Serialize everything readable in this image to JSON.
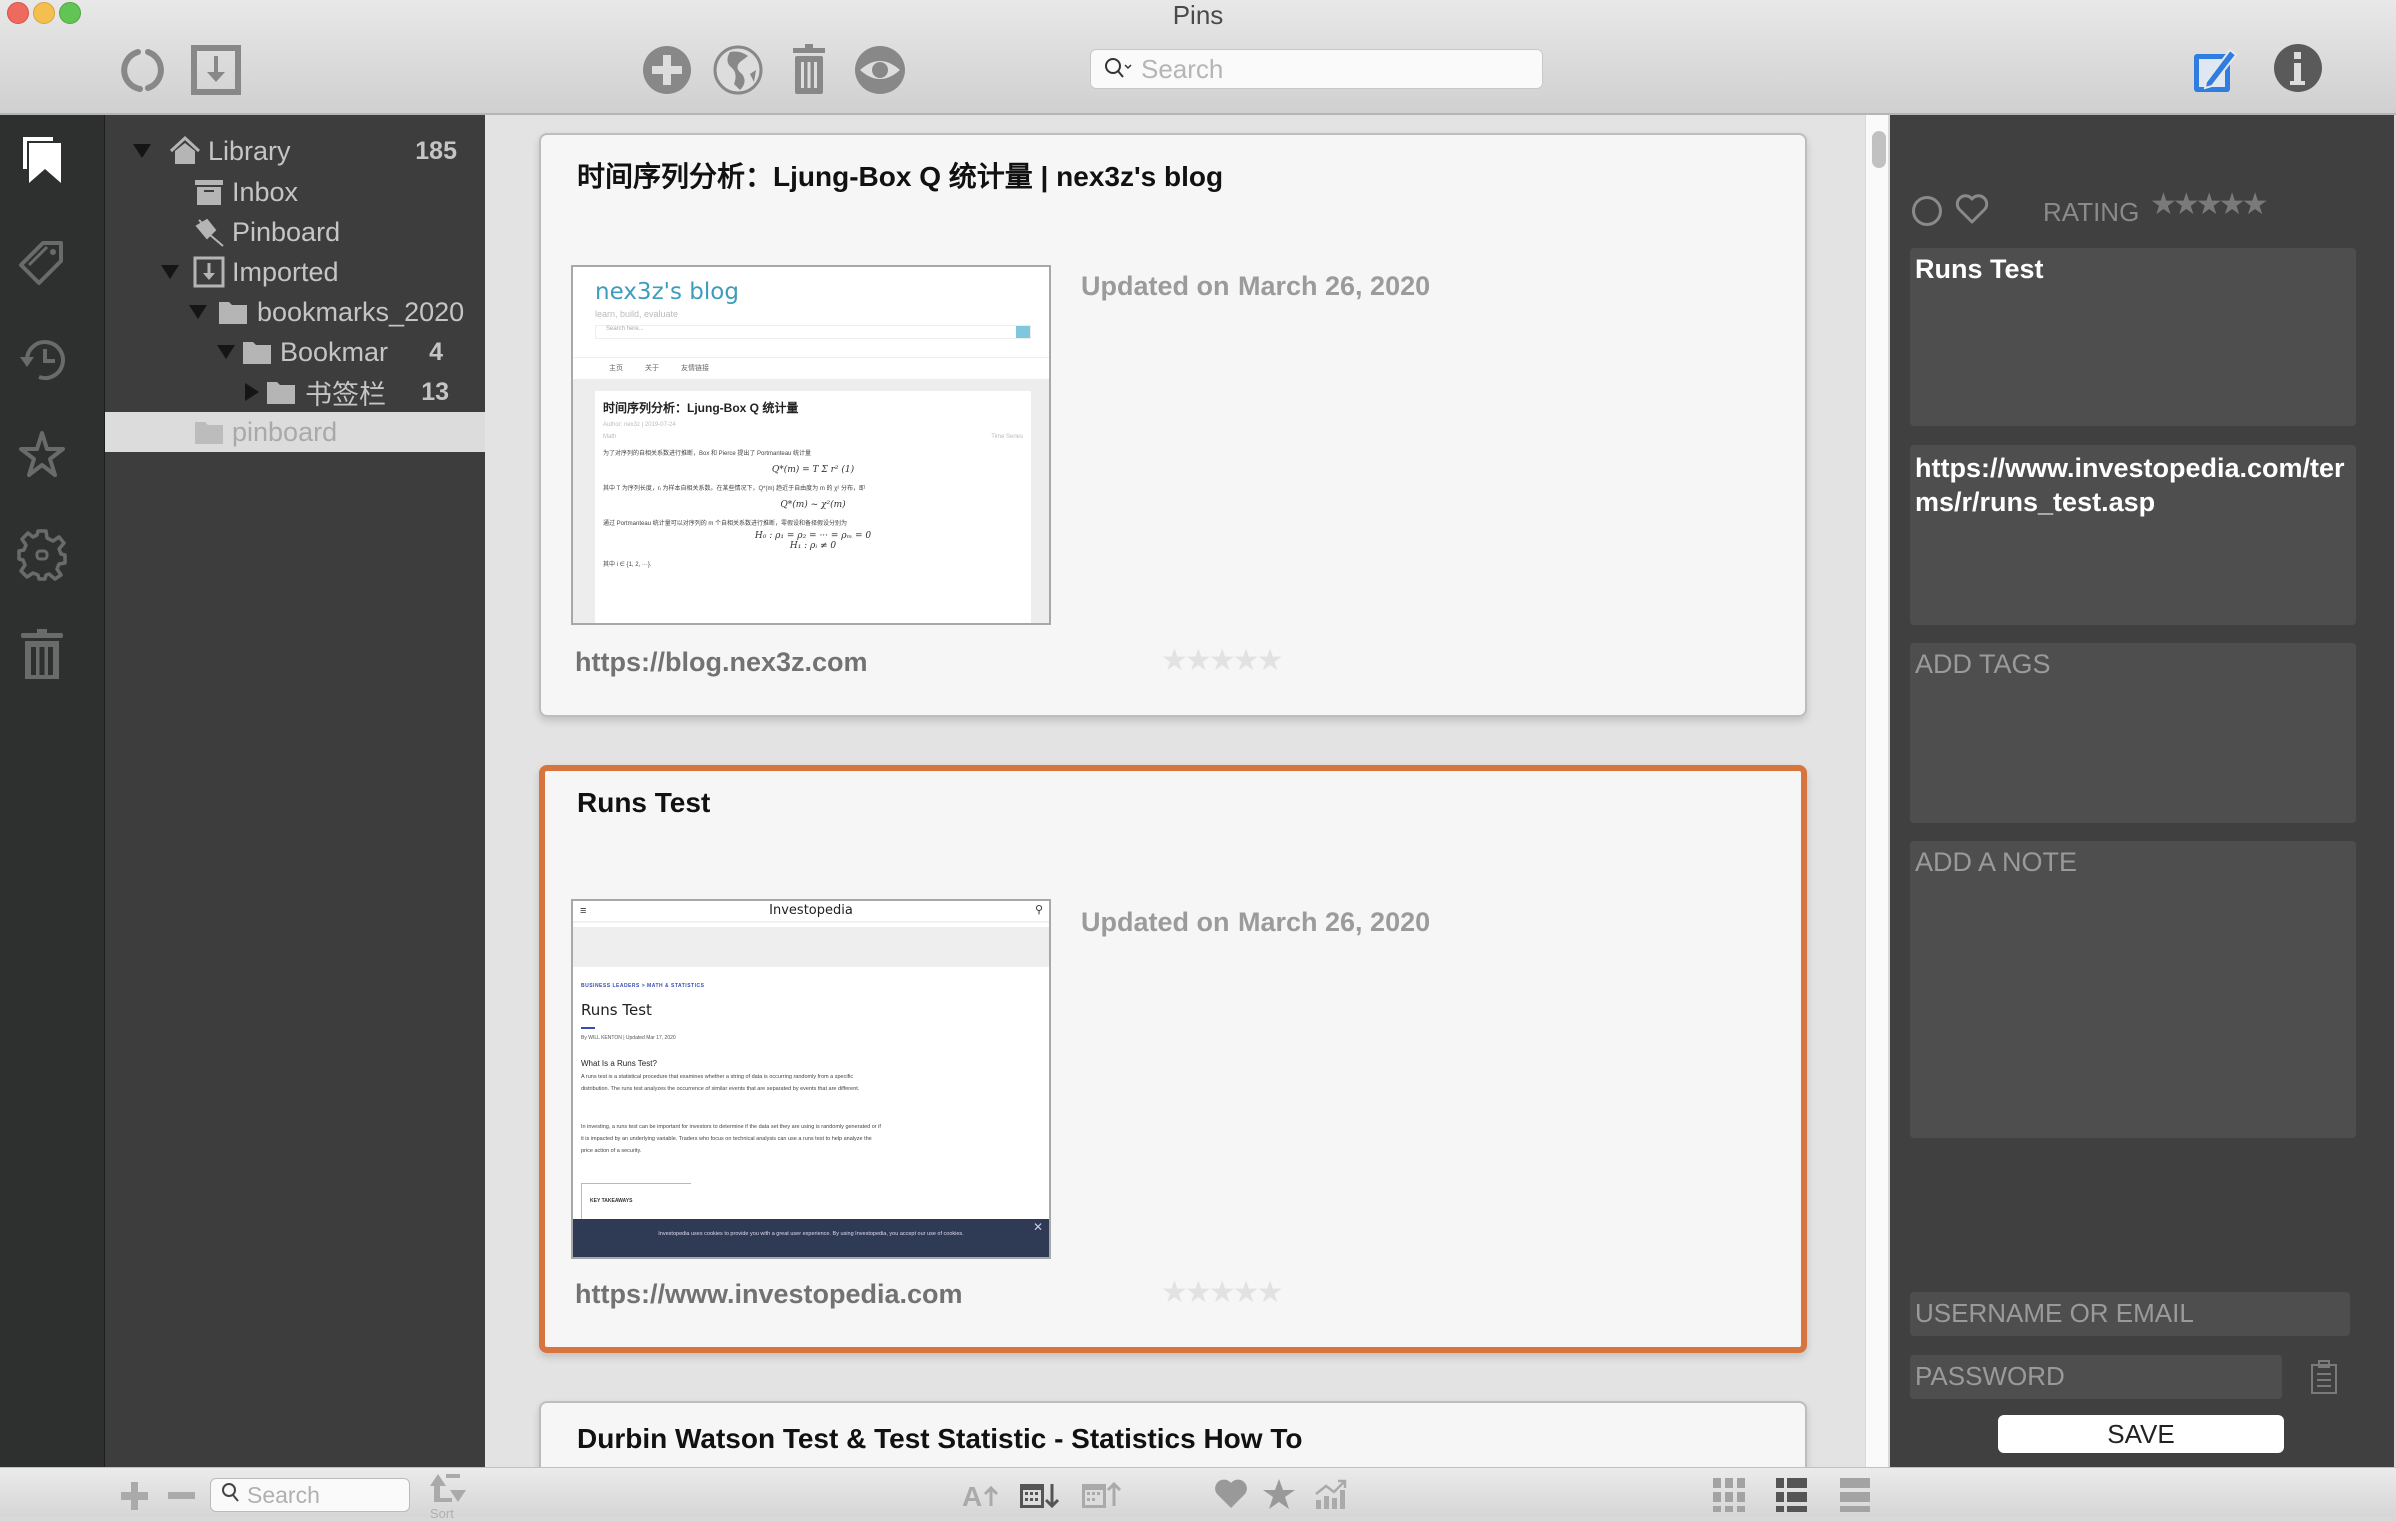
{
  "window": {
    "title": "Pins"
  },
  "toolbar": {
    "left_icons": [
      {
        "name": "refresh-icon"
      },
      {
        "name": "import-icon"
      }
    ],
    "center_icons": [
      {
        "name": "add-icon"
      },
      {
        "name": "globe-icon"
      },
      {
        "name": "trash-icon"
      },
      {
        "name": "eye-icon"
      }
    ],
    "search": {
      "placeholder": "Search",
      "value": ""
    },
    "right_icons": [
      {
        "name": "edit-icon",
        "color": "#2f7de1"
      },
      {
        "name": "info-icon"
      }
    ]
  },
  "rail": {
    "items": [
      {
        "name": "bookmarks-icon",
        "active": true
      },
      {
        "name": "tags-icon",
        "active": false
      },
      {
        "name": "history-icon",
        "active": false
      },
      {
        "name": "star-icon",
        "active": false
      },
      {
        "name": "settings-icon",
        "active": false
      },
      {
        "name": "trash-icon",
        "active": false
      }
    ]
  },
  "tree": {
    "items": [
      {
        "label": "Library",
        "count": "185",
        "icon": "home-icon",
        "disclosure": "down",
        "level": 0
      },
      {
        "label": "Inbox",
        "count": "",
        "icon": "inbox-icon",
        "disclosure": "",
        "level": 1
      },
      {
        "label": "Pinboard",
        "count": "",
        "icon": "pin-icon",
        "disclosure": "",
        "level": 1
      },
      {
        "label": "Imported",
        "count": "",
        "icon": "import-icon",
        "disclosure": "down",
        "level": 1
      },
      {
        "label": "bookmarks_2020",
        "count": "",
        "icon": "folder-icon",
        "disclosure": "down",
        "level": 2
      },
      {
        "label": "Bookmar",
        "count": "4",
        "icon": "folder-icon",
        "disclosure": "down",
        "level": 3
      },
      {
        "label": "书签栏",
        "count": "13",
        "icon": "folder-icon",
        "disclosure": "right",
        "level": 4
      },
      {
        "label": "pinboard",
        "count": "",
        "icon": "folder-icon",
        "disclosure": "",
        "level": 1,
        "selected": true
      }
    ]
  },
  "cards": [
    {
      "title": "时间序列分析：Ljung-Box Q 统计量 | nex3z's blog",
      "updated_label": "Updated on",
      "updated_date": "March 26, 2020",
      "url": "https://blog.nex3z.com",
      "rating": 0,
      "selected": false,
      "thumb": {
        "brand": "nex3z's blog",
        "tagline": "learn, build, evaluate",
        "search_placeholder": "Search here...",
        "nav": [
          "主页",
          "关于",
          "友情链接"
        ],
        "article_title": "时间序列分析：Ljung-Box Q 统计量",
        "meta": "Author: nex3z  |  2019-07-24",
        "category": "Math",
        "tag": "Time Series",
        "line1": "为了对序列的自相关系数进行推断，Box 和 Pierce 提出了 Portmanteau 统计量",
        "formula1": "Q*(m) = T Σ r²        (1)",
        "line2": "其中 T 为序列长度，rᵢ 为样本自相关系数。在某些情况下，Q*(m) 趋近于自由度为 m 的 χ² 分布，即",
        "formula2": "Q*(m) ~ χ²(m)",
        "line3": "通过 Portmanteau 统计量可以对序列的 m 个自相关系数进行推断，零假设和备择假设分别为",
        "formula3": "H₀ : ρ₁ = ρ₂ = ··· = ρₘ = 0",
        "formula4": "H₁ : ρᵢ ≠ 0",
        "line4": "其中 i ∈ {1, 2, ···}."
      }
    },
    {
      "title": "Runs Test",
      "updated_label": "Updated on",
      "updated_date": "March 26, 2020",
      "url": "https://www.investopedia.com",
      "rating": 0,
      "selected": true,
      "thumb": {
        "logo": "Investopedia",
        "breadcrumb": "BUSINESS LEADERS  >  MATH & STATISTICS",
        "article_title": "Runs Test",
        "byline": "By WILL KENTON  |  Updated Mar 17, 2020",
        "heading": "What Is a Runs Test?",
        "para1": "A runs test is a statistical procedure that examines whether a string of data is occurring randomly from a specific distribution. The runs test analyzes the occurrence of similar events that are separated by events that are different.",
        "para2": "In investing, a runs test can be important for investors to determine if the data set they are using is randomly generated or if it is impacted by an underlying variable. Traders who focus on technical analysis can use a runs test to help analyze the price action of a security.",
        "key_takeaways": "KEY TAKEAWAYS",
        "cookie": "Investopedia uses cookies to provide you with a great user experience. By using Investopedia, you accept our use of cookies."
      }
    },
    {
      "title": "Durbin Watson Test & Test Statistic - Statistics How To",
      "selected": false
    }
  ],
  "inspector": {
    "rating_label": "RATING",
    "rating": 0,
    "title_value": "Runs Test",
    "url_value": "https://www.investopedia.com/terms/r/runs_test.asp",
    "tags_placeholder": "ADD TAGS",
    "note_placeholder": "ADD A NOTE",
    "username_placeholder": "USERNAME OR EMAIL",
    "password_placeholder": "PASSWORD",
    "save_label": "SAVE"
  },
  "bottombar": {
    "search_placeholder": "Search",
    "sort_label": "Sort",
    "sort_icons": [
      "sort-alpha-icon",
      "sort-date-desc-icon",
      "sort-date-asc-icon"
    ],
    "filter_icons": [
      "heart-icon",
      "star-icon",
      "trending-icon"
    ],
    "view_icons": [
      "grid-view-icon",
      "list-view-icon",
      "compact-view-icon"
    ],
    "active_view": "list-view-icon"
  },
  "colors": {
    "accent_selected": "#d8743d",
    "edit_blue": "#2f7de1"
  }
}
